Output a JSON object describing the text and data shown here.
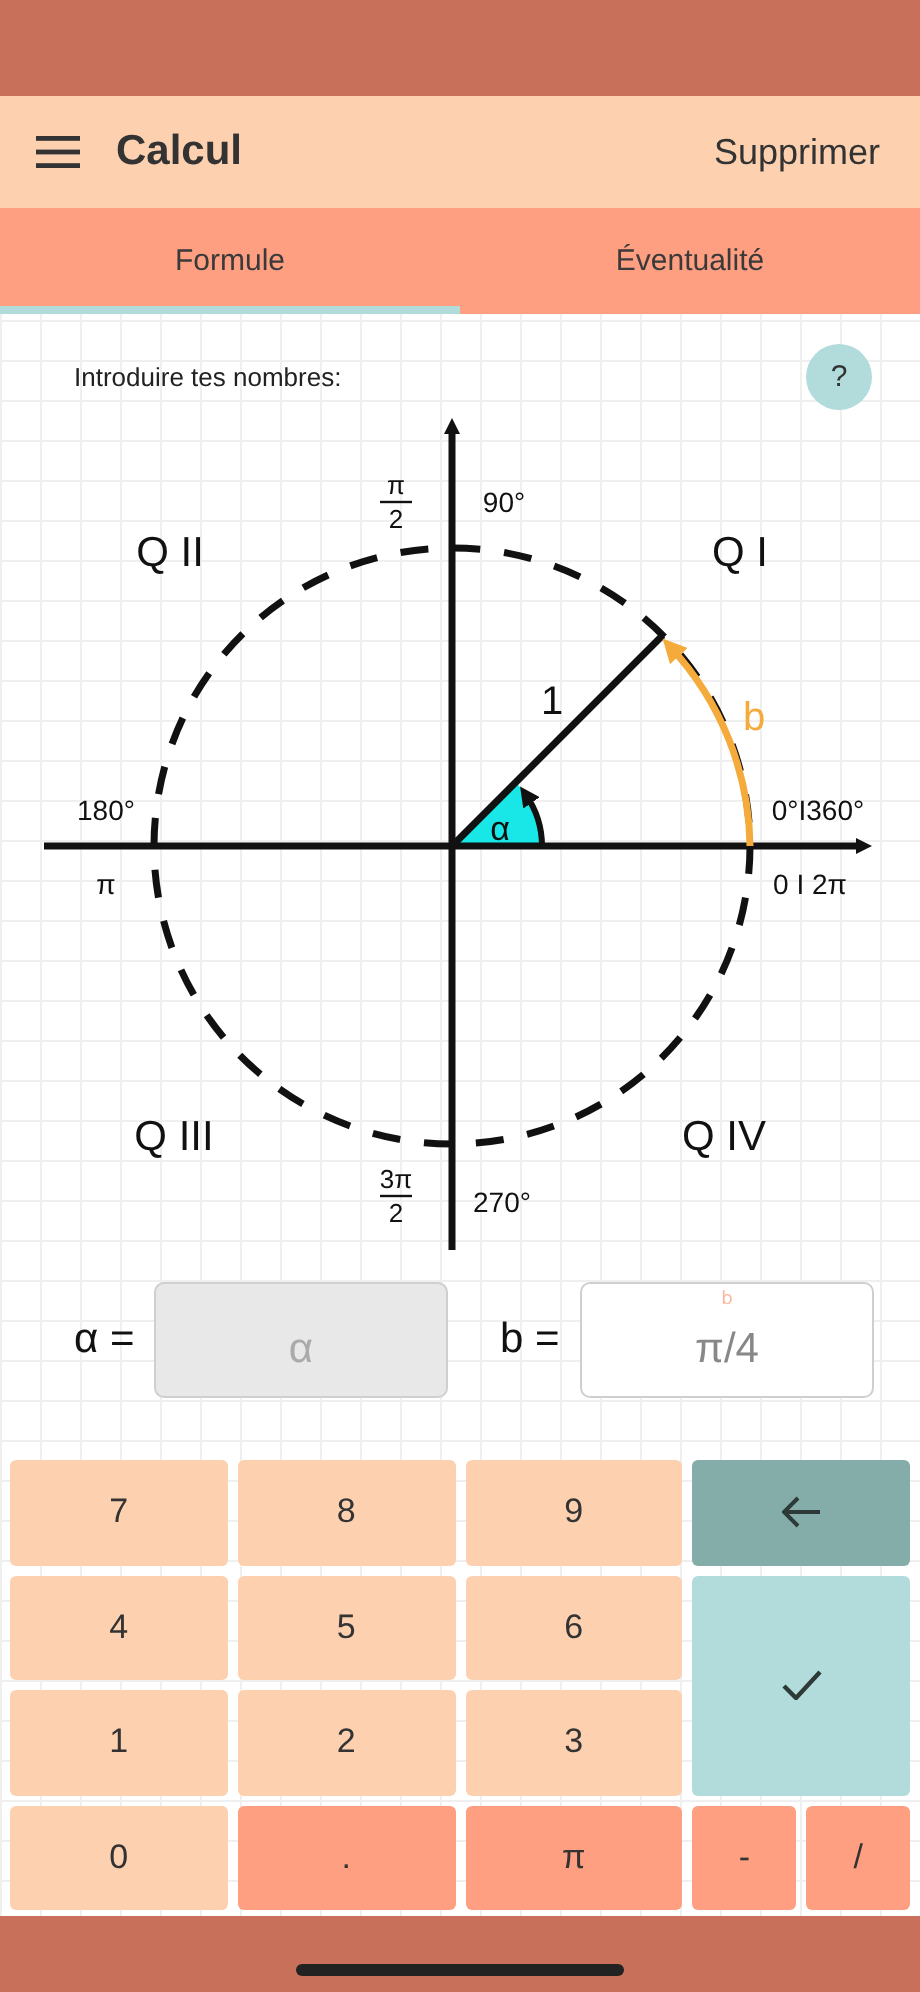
{
  "header": {
    "title": "Calcul",
    "action": "Supprimer"
  },
  "tabs": [
    {
      "label": "Formule",
      "selected": true
    },
    {
      "label": "Éventualité",
      "selected": false
    }
  ],
  "prompt": "Introduire tes nombres:",
  "help": "?",
  "diagram": {
    "quadrants": [
      "Q II",
      "Q I",
      "Q III",
      "Q IV"
    ],
    "radius_label": "1",
    "arc_label": "b",
    "angle_label": "α",
    "deg_90": "90°",
    "deg_180": "180°",
    "deg_0": "0°I360°",
    "deg_270": "270°",
    "rad_pi": "π",
    "rad_0": "0 I 2π",
    "frac_top": {
      "num": "π",
      "den": "2"
    },
    "frac_bottom": {
      "num": "3π",
      "den": "2"
    }
  },
  "fields": [
    {
      "label": "α =",
      "placeholder": "α",
      "disabled": true
    },
    {
      "label": "b =",
      "floating_label": "b",
      "value": "π/4",
      "disabled": false
    }
  ],
  "keys": [
    {
      "kind": "digit",
      "label": "7"
    },
    {
      "kind": "digit",
      "label": "8"
    },
    {
      "kind": "digit",
      "label": "9"
    },
    {
      "kind": "back"
    },
    {
      "kind": "digit",
      "label": "4"
    },
    {
      "kind": "digit",
      "label": "5"
    },
    {
      "kind": "digit",
      "label": "6"
    },
    {
      "kind": "enter"
    },
    {
      "kind": "digit",
      "label": "1"
    },
    {
      "kind": "digit",
      "label": "2"
    },
    {
      "kind": "digit",
      "label": "3"
    },
    {
      "kind": "digit",
      "label": "0"
    },
    {
      "kind": "symbol",
      "label": "."
    },
    {
      "kind": "symbol",
      "label": "π"
    },
    {
      "kind": "small",
      "label": "-"
    },
    {
      "kind": "small",
      "label": "/"
    }
  ]
}
